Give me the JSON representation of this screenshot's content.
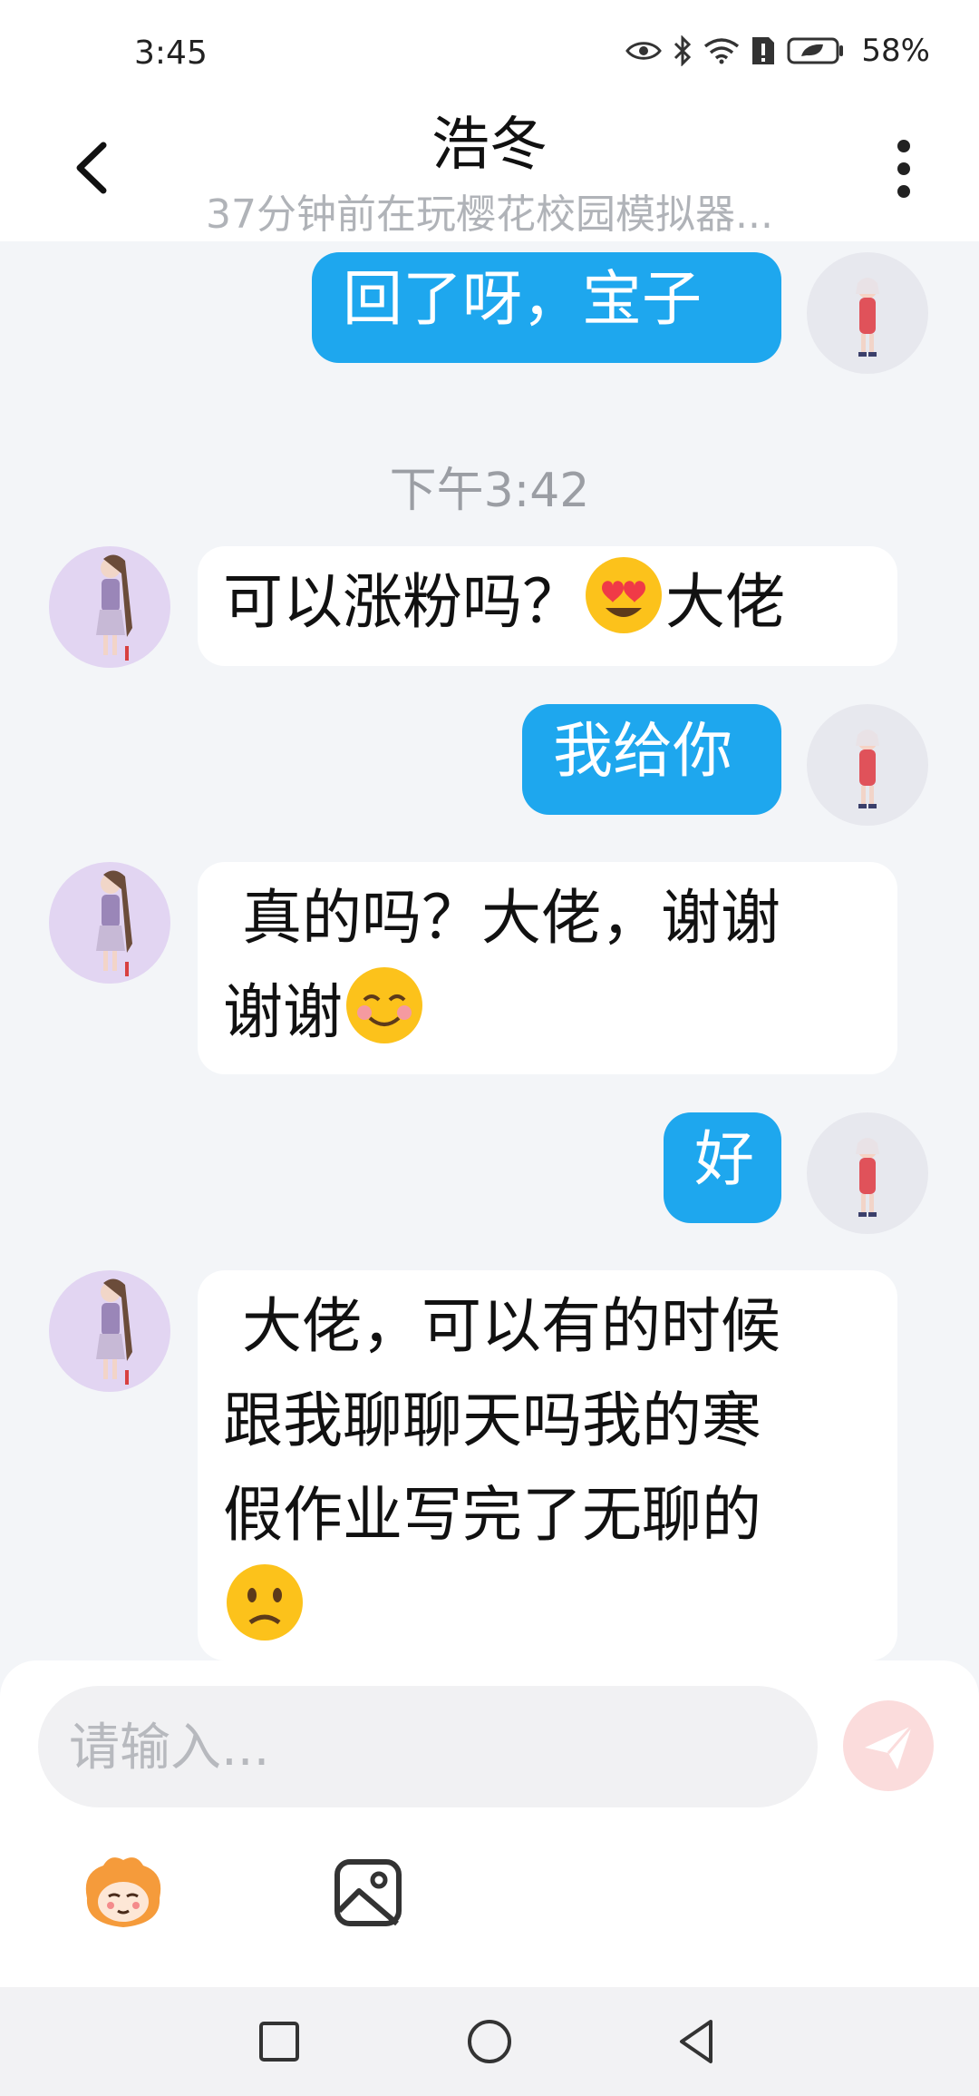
{
  "status": {
    "time": "3:45",
    "battery": "58%"
  },
  "header": {
    "title": "浩冬",
    "subtitle": "37分钟前在玩樱花校园模拟器..."
  },
  "messages": [
    {
      "side": "out",
      "text": "回了呀，宝子"
    },
    {
      "type": "time",
      "text": "下午3:42"
    },
    {
      "side": "in",
      "text": "可以涨粉吗？",
      "emoji": "heart-eyes-emoji",
      "text_after": "大佬"
    },
    {
      "side": "out",
      "text": "我给你"
    },
    {
      "side": "in",
      "line1": " 真的吗？大佬，谢谢",
      "line2": "谢谢",
      "emoji": "smiling-blush-emoji"
    },
    {
      "side": "out",
      "text": "好"
    },
    {
      "side": "in",
      "line1": " 大佬，可以有的时候",
      "line2": "跟我聊聊天吗我的寒",
      "line3": "假作业写完了无聊的",
      "emoji": "slightly-frowning-emoji"
    }
  ],
  "composer": {
    "placeholder": "请输入..."
  },
  "icons": {
    "back": "back-arrow-icon",
    "more": "more-vertical-icon",
    "send": "paper-plane-icon",
    "sticker": "sticker-mascot-icon",
    "image": "image-picker-icon"
  },
  "colors": {
    "outgoing_bubble": "#1ea7ee",
    "incoming_bubble": "#ffffff",
    "chat_background": "#f3f5f8",
    "send_button": "#fbdcdc"
  }
}
